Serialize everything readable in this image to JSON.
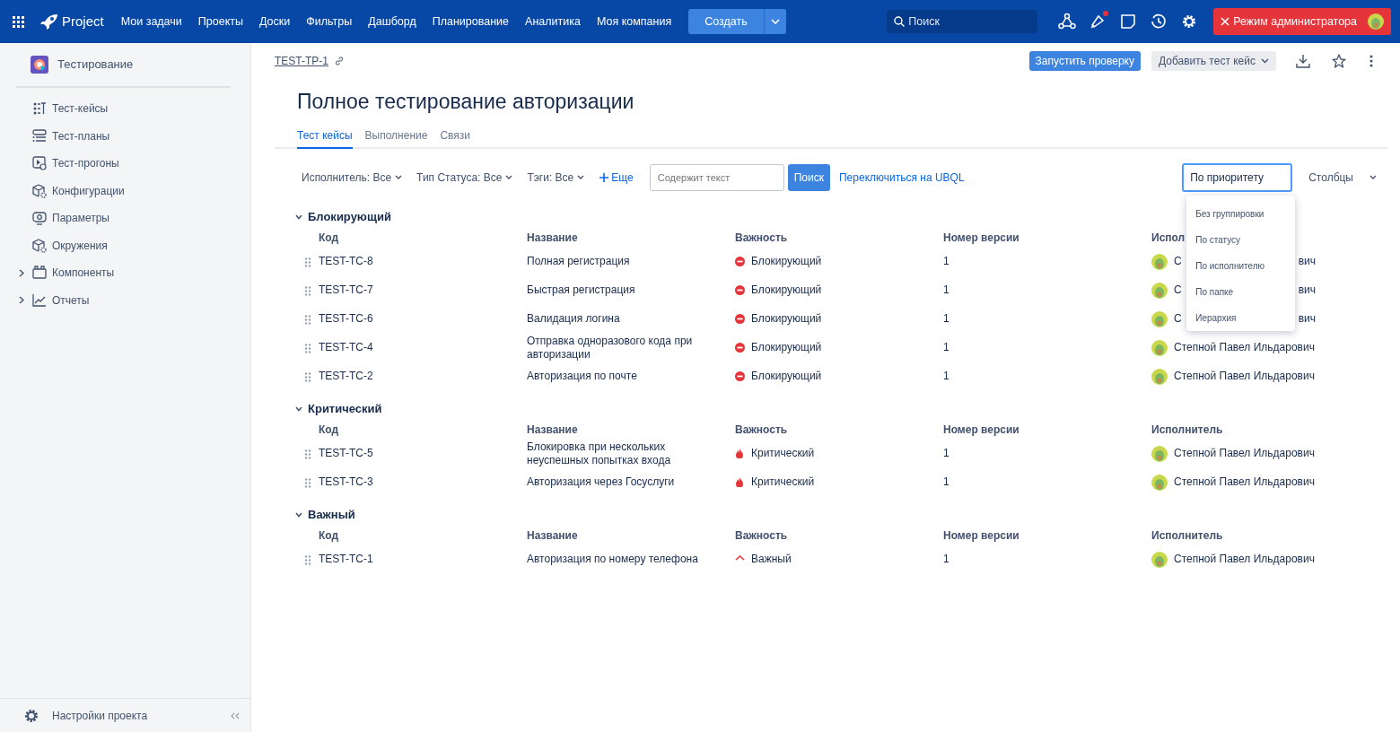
{
  "topbar": {
    "logo": "Project",
    "menu": [
      "Мои задачи",
      "Проекты",
      "Доски",
      "Фильтры",
      "Дашборд",
      "Планирование",
      "Аналитика",
      "Моя компания"
    ],
    "create": "Создать",
    "search": {
      "placeholder": "Поиск"
    },
    "notification_dot": true,
    "admin": "Режим администратора"
  },
  "sidebar": {
    "project": "Тестирование",
    "items": [
      {
        "label": "Тест-кейсы",
        "kind": "link"
      },
      {
        "label": "Тест-планы",
        "kind": "link"
      },
      {
        "label": "Тест-прогоны",
        "kind": "link"
      },
      {
        "label": "Конфигурации",
        "kind": "link"
      },
      {
        "label": "Параметры",
        "kind": "link"
      },
      {
        "label": "Окружения",
        "kind": "link"
      },
      {
        "label": "Компоненты",
        "kind": "group"
      },
      {
        "label": "Отчеты",
        "kind": "group"
      }
    ],
    "settings": "Настройки проекта"
  },
  "breadcrumb": "TEST-TP-1",
  "actions": {
    "run": "Запустить проверку",
    "add": "Добавить тест кейс"
  },
  "title": "Полное тестирование авторизации",
  "tabs": [
    {
      "label": "Тест кейсы",
      "selected": true
    },
    {
      "label": "Выполнение",
      "selected": false
    },
    {
      "label": "Связи",
      "selected": false
    }
  ],
  "filters": [
    "Исполнитель: Все",
    "Тип Статуса: Все",
    "Тэги: Все"
  ],
  "more": "Еще",
  "text_search": {
    "placeholder": "Содержит текст"
  },
  "search_button": "Поиск",
  "ubql_link": "Переключиться на UBQL",
  "grouping": {
    "value": "По приоритету",
    "expanded": true,
    "options": [
      "Без группировки",
      "По статусу",
      "По исполнителю",
      "По папке",
      "Иерархия"
    ]
  },
  "columns_button": "Столбцы",
  "groups": [
    {
      "title": "Блокирующий",
      "expanded": true,
      "columns": [
        "Код",
        "Название",
        "Важность",
        "Номер версии",
        "Испол"
      ],
      "rows": [
        {
          "code": "TEST-TC-8",
          "name": "Полная регистрация",
          "severity": {
            "kind": "blocker",
            "label": "Блокирующий"
          },
          "version": "1",
          "assignee": "С",
          "assignee_end": "вич"
        },
        {
          "code": "TEST-TC-7",
          "name": "Быстрая регистрация",
          "severity": {
            "kind": "blocker",
            "label": "Блокирующий"
          },
          "version": "1",
          "assignee": "С",
          "assignee_end": "вич"
        },
        {
          "code": "TEST-TC-6",
          "name": "Валидация логина",
          "severity": {
            "kind": "blocker",
            "label": "Блокирующий"
          },
          "version": "1",
          "assignee": "С",
          "assignee_end": "вич"
        },
        {
          "code": "TEST-TC-4",
          "name": "Отправка одноразового кода при авторизации",
          "severity": {
            "kind": "blocker",
            "label": "Блокирующий"
          },
          "version": "1",
          "assignee": "Степной Павел Ильдарович"
        },
        {
          "code": "TEST-TC-2",
          "name": "Авторизация по почте",
          "severity": {
            "kind": "blocker",
            "label": "Блокирующий"
          },
          "version": "1",
          "assignee": "Степной Павел Ильдарович"
        }
      ]
    },
    {
      "title": "Критический",
      "expanded": true,
      "columns": [
        "Код",
        "Название",
        "Важность",
        "Номер версии",
        "Исполнитель"
      ],
      "rows": [
        {
          "code": "TEST-TC-5",
          "name": "Блокировка при нескольких неуспешных попытках входа",
          "severity": {
            "kind": "critical",
            "label": "Критический"
          },
          "version": "1",
          "assignee": "Степной Павел Ильдарович"
        },
        {
          "code": "TEST-TC-3",
          "name": "Авторизация через Госуслуги",
          "severity": {
            "kind": "critical",
            "label": "Критический"
          },
          "version": "1",
          "assignee": "Степной Павел Ильдарович"
        }
      ]
    },
    {
      "title": "Важный",
      "expanded": true,
      "columns": [
        "Код",
        "Название",
        "Важность",
        "Номер версии",
        "Исполнитель"
      ],
      "rows": [
        {
          "code": "TEST-TC-1",
          "name": "Авторизация по номеру телефона",
          "severity": {
            "kind": "major",
            "label": "Важный"
          },
          "version": "1",
          "assignee": "Степной Павел Ильдарович"
        }
      ]
    }
  ]
}
